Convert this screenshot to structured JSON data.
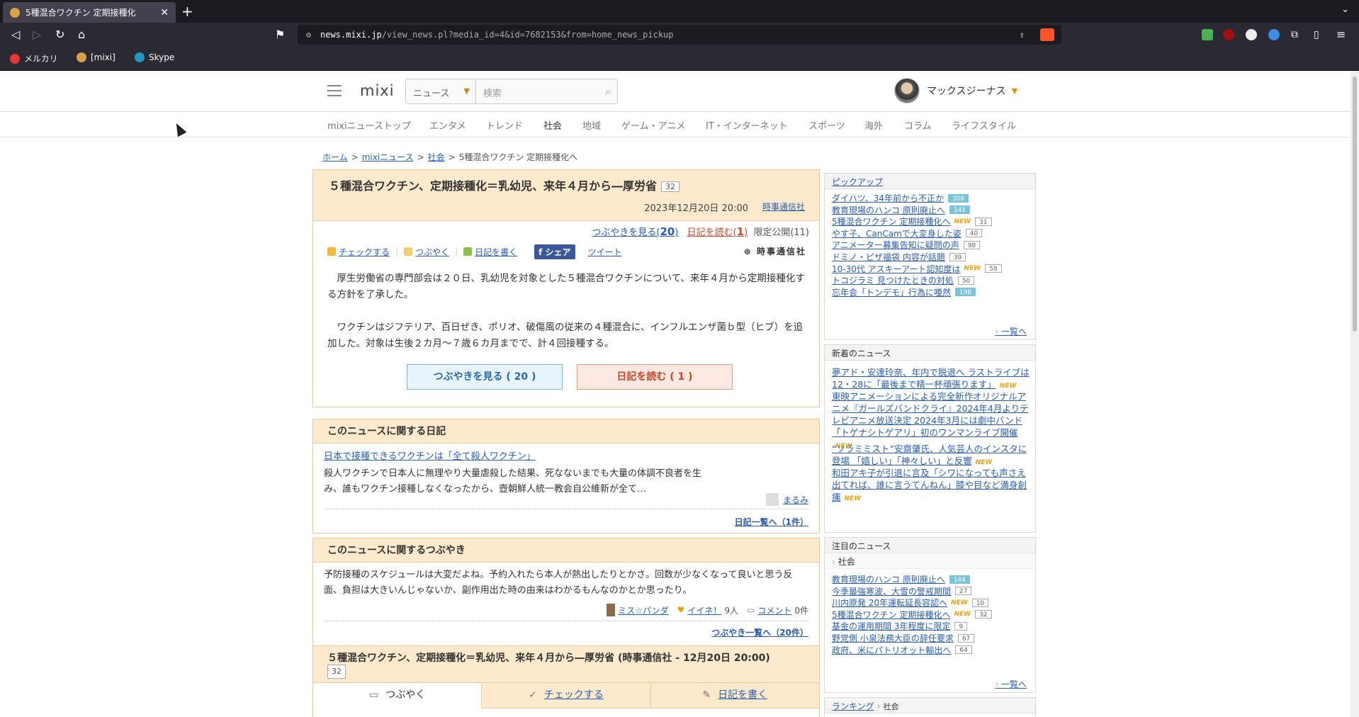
{
  "browser": {
    "tab_title": "5種混合ワクチン 定期接種化",
    "url_host": "news.mixi.jp",
    "url_path": "/view_news.pl?media_id=4&id=7682153&from=home_news_pickup",
    "bookmarks": [
      "メルカリ",
      "[mixi]",
      "Skype"
    ]
  },
  "site": {
    "logo": "mixi",
    "category_select": "ニュース",
    "search_placeholder": "検索",
    "username": "マックスジーナス",
    "nav": [
      "mixiニューストップ",
      "エンタメ",
      "トレンド",
      "社会",
      "地域",
      "ゲーム・アニメ",
      "IT・インターネット",
      "スポーツ",
      "海外",
      "コラム",
      "ライフスタイル"
    ]
  },
  "breadcrumb": {
    "home": "ホーム",
    "news": "mixiニュース",
    "category": "社会",
    "current": "5種混合ワクチン 定期接種化へ",
    "sep": ">"
  },
  "article": {
    "title": "５種混合ワクチン、定期接種化＝乳幼児、来年４月から―厚労省",
    "count": "32",
    "date": "2023年12月20日 20:00",
    "source": "時事通信社",
    "stats_tweets_label": "つぶやきを見る(",
    "stats_tweets_num": "20",
    "stats_diary_label": "日記を読む(",
    "stats_diary_num": "1",
    "stats_close": ")",
    "stats_limited": "限定公開(11)",
    "action_check": "チェックする",
    "action_tweet": "つぶやく",
    "action_diary": "日記を書く",
    "action_fb": "シェア",
    "action_twitter": "ツイート",
    "publisher_logo": "時事通信社",
    "body_p1": "厚生労働省の専門部会は２０日、乳幼児を対象とした５種混合ワクチンについて、来年４月から定期接種化する方針を了承した。",
    "body_p2": "ワクチンはジフテリア、百日ぜき、ポリオ、破傷風の従来の４種混合に、インフルエンザ菌ｂ型（ヒブ）を追加した。対象は生後２カ月～７歳６カ月までで、計４回接種する。",
    "btn_tweets": "つぶやきを見る ( 20 )",
    "btn_diary": "日記を読む ( 1 )"
  },
  "diary_section": {
    "heading": "このニュースに関する日記",
    "link": "日本で接種できるワクチンは「全て殺人ワクチン」",
    "excerpt": "殺人ワクチンで日本人に無理やり大量虐殺した結果、死なないまでも大量の体調不良者を生み、誰もワクチン接種しなくなったから、壺朝鮮人統一教会自公維新が全て…",
    "author": "まるみ",
    "more": "日記一覧へ（1件）"
  },
  "tweet_section": {
    "heading": "このニュースに関するつぶやき",
    "text": "予防接種のスケジュールは大変だよね。予約入れたら本人が熱出したりとかさ。回数が少なくなって良いと思う反面、負担は大きいんじゃないか、副作用出た時の由来はわかるもんなのかとか思ったり。",
    "author": "ミス☆パンダ",
    "like": "イイネ！",
    "like_count": "9人",
    "comment": "コメント",
    "comment_count": "0件",
    "more": "つぶやき一覧へ（20件）"
  },
  "bottom": {
    "title": "５種混合ワクチン、定期接種化＝乳幼児、来年４月から―厚労省 (時事通信社 - 12月20日 20:00)",
    "count": "32",
    "tab_tweet": "つぶやく",
    "tab_check": "チェックする",
    "tab_diary": "日記を書く"
  },
  "pickup": {
    "heading": "ピックアップ",
    "items": [
      {
        "title": "ダイハツ、34年前から不正か",
        "count": "306",
        "hot": true,
        "new": false
      },
      {
        "title": "教育現場のハンコ 原則廃止へ",
        "count": "141",
        "hot": true,
        "new": false
      },
      {
        "title": "5種混合ワクチン 定期接種化へ",
        "count": "31",
        "hot": false,
        "new": true
      },
      {
        "title": "やす子、CanCamで大変身した姿",
        "count": "40",
        "hot": false,
        "new": false
      },
      {
        "title": "アニメーター募集告知に疑問の声",
        "count": "98",
        "hot": false,
        "new": false
      },
      {
        "title": "ドミノ・ピザ福袋 内容が話題",
        "count": "39",
        "hot": false,
        "new": false
      },
      {
        "title": "10-30代 アスキーアート認知度は",
        "count": "58",
        "hot": false,
        "new": true
      },
      {
        "title": "トコジラミ 見つけたときの対処",
        "count": "50",
        "hot": false,
        "new": false
      },
      {
        "title": "忘年会「トンデモ」行為に唖然",
        "count": "196",
        "hot": true,
        "new": false
      }
    ],
    "more": "一覧へ"
  },
  "new_news": {
    "heading": "新着のニュース",
    "items": [
      "夢アド・安達玲奈、年内で脱退へ ラストライブは12・28に「最後まで精一杯頑張ります」",
      "東映アニメーションによる完全新作オリジナルアニメ『ガールズバンドクライ』2024年4月よりテレビアニメ放送決定 2024年3月には劇中バンド「トゲナシトゲアリ」初のワンマンライブ開催",
      "“ソラミミスト”安齋肇氏、人気芸人のインスタに登場 「嬉しい」「神々しい」と反響",
      "和田アキ子が引退に言及「シワになっても声さえ出てれば、誰に言うてんねん」膝や目など満身創痍"
    ],
    "new_label": "NEW"
  },
  "featured": {
    "heading": "注目のニュース",
    "subheading": "社会",
    "items": [
      {
        "title": "教育現場のハンコ 原則廃止へ",
        "count": "144",
        "hot": true,
        "new": false
      },
      {
        "title": "今季最強寒波、大雪の警戒期間",
        "count": "27",
        "hot": false,
        "new": false
      },
      {
        "title": "川内原発 20年運転延長容認へ",
        "count": "10",
        "hot": false,
        "new": true
      },
      {
        "title": "5種混合ワクチン 定期接種化へ",
        "count": "32",
        "hot": false,
        "new": true
      },
      {
        "title": "基金の運用期間 3年程度に限定",
        "count": "9",
        "hot": false,
        "new": false
      },
      {
        "title": "野党側 小泉法務大臣の辞任要求",
        "count": "67",
        "hot": false,
        "new": false
      },
      {
        "title": "政府、米にパトリオット輸出へ",
        "count": "64",
        "hot": false,
        "new": false
      }
    ],
    "more": "一覧へ"
  },
  "ranking": {
    "heading": "ランキング",
    "sub": "社会"
  }
}
